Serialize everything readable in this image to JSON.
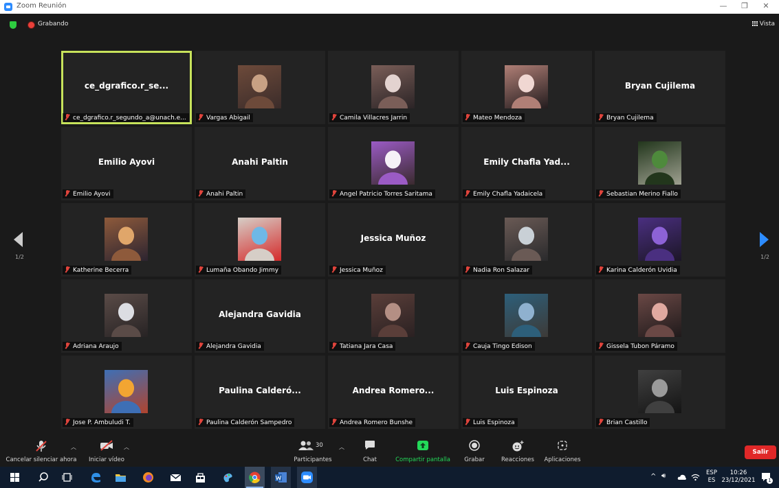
{
  "window": {
    "title": "Zoom Reunión"
  },
  "topbar": {
    "recording_label": "Grabando",
    "view_label": "Vista"
  },
  "pagination": {
    "left": "1/2",
    "right": "1/2"
  },
  "participants": [
    {
      "name": "ce_dgrafico.r_segundo_a@unach.e...",
      "display": "ce_dgrafico.r_se...",
      "video": false,
      "active": true
    },
    {
      "name": "Vargas Abigail",
      "video": true,
      "photo_colors": [
        "#c8a184",
        "#6d4a3a",
        "#3b2c2a"
      ]
    },
    {
      "name": "Camila Villacres Jarrin",
      "video": true,
      "photo_colors": [
        "#e3d3d0",
        "#7a5e58",
        "#2b2426"
      ]
    },
    {
      "name": "Mateo Mendoza",
      "video": true,
      "photo_colors": [
        "#f0d7d2",
        "#b07f76",
        "#231c1e"
      ]
    },
    {
      "name": "Bryan Cujilema",
      "display": "Bryan Cujilema",
      "video": false
    },
    {
      "name": "Emilio Ayovi",
      "display": "Emilio Ayovi",
      "video": false
    },
    {
      "name": "Anahi Paltin",
      "display": "Anahi Paltin",
      "video": false
    },
    {
      "name": "Angel Patricio Torres Saritama",
      "video": true,
      "photo_colors": [
        "#f6f1f7",
        "#9b5bc5",
        "#3a2a2e"
      ]
    },
    {
      "name": "Emily Chafla Yadaicela",
      "display": "Emily Chafla Yad...",
      "video": false
    },
    {
      "name": "Sebastian Merino Fiallo",
      "video": true,
      "photo_colors": [
        "#4e8a3c",
        "#22361c",
        "#9ea090"
      ]
    },
    {
      "name": "Katherine Becerra",
      "video": true,
      "photo_colors": [
        "#e0a66a",
        "#8e5a3b",
        "#2c2430"
      ]
    },
    {
      "name": "Lumaña Obando Jimmy",
      "video": true,
      "photo_colors": [
        "#6fb8e6",
        "#d6cec7",
        "#d52b2b"
      ]
    },
    {
      "name": "Jessica Muñoz",
      "display": "Jessica Muñoz",
      "video": false
    },
    {
      "name": "Nadia Ron Salazar",
      "video": true,
      "photo_colors": [
        "#c9d0d6",
        "#6a5a55",
        "#2a2a2c"
      ]
    },
    {
      "name": "Karina Calderón Uvidia",
      "video": true,
      "photo_colors": [
        "#8d62d6",
        "#4a2f80",
        "#1c1626"
      ]
    },
    {
      "name": "Adriana Araujo",
      "video": true,
      "photo_colors": [
        "#dcdde2",
        "#5a4b47",
        "#272324"
      ]
    },
    {
      "name": "Alejandra Gavidia",
      "display": "Alejandra Gavidia",
      "video": false
    },
    {
      "name": "Tatiana Jara Casa",
      "video": true,
      "photo_colors": [
        "#b48f84",
        "#5a3e39",
        "#2a2122"
      ]
    },
    {
      "name": "Cauja Tingo Edison",
      "video": true,
      "photo_colors": [
        "#8fb1cf",
        "#2d5f7a",
        "#3d3a37"
      ]
    },
    {
      "name": "Gissela Tubon Páramo",
      "video": true,
      "photo_colors": [
        "#e0a9a0",
        "#6a4845",
        "#1f1a1b"
      ]
    },
    {
      "name": "Jose P. Ambuludi T.",
      "video": true,
      "photo_colors": [
        "#f2a532",
        "#3e6fb5",
        "#b0442e"
      ]
    },
    {
      "name": "Paulina Calderón Sampedro",
      "display": "Paulina Calderó...",
      "video": false
    },
    {
      "name": "Andrea Romero Bunshe",
      "display": "Andrea Romero...",
      "video": false
    },
    {
      "name": "Luis Espinoza",
      "display": "Luis Espinoza",
      "video": false
    },
    {
      "name": "Brian Castillo",
      "video": true,
      "photo_colors": [
        "#9a9a9a",
        "#404040",
        "#141414"
      ]
    }
  ],
  "toolbar": {
    "mute_label": "Cancelar silenciar ahora",
    "video_label": "Iniciar vídeo",
    "participants_label": "Participantes",
    "participants_count": "30",
    "chat_label": "Chat",
    "share_label": "Compartir pantalla",
    "record_label": "Grabar",
    "reactions_label": "Reacciones",
    "apps_label": "Aplicaciones",
    "leave_label": "Salir"
  },
  "taskbar": {
    "language": "ESP",
    "language_sub": "ES",
    "time": "10:26",
    "date": "23/12/2021",
    "notification_count": "1"
  },
  "colors": {
    "accent_blue": "#2d8cff",
    "share_green": "#23d959",
    "leave_red": "#e02828",
    "active_border": "#c7e35b",
    "muted_red": "#e0443c"
  }
}
